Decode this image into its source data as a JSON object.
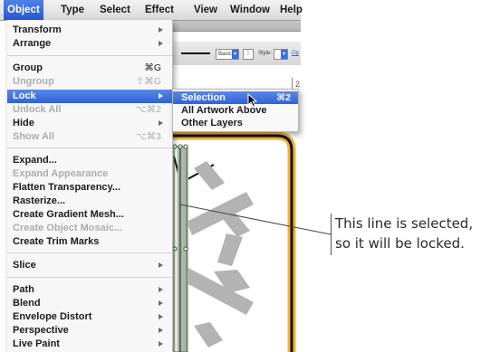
{
  "menubar": {
    "items": [
      {
        "label": "Object",
        "active": true
      },
      {
        "label": "Type"
      },
      {
        "label": "Select"
      },
      {
        "label": "Effect"
      },
      {
        "label": "View"
      },
      {
        "label": "Window"
      },
      {
        "label": "Help"
      }
    ]
  },
  "control_strip": {
    "brush_select": "Basic",
    "style_label": "Style:",
    "opacity_label": "Op"
  },
  "ruler": {
    "mark": "2"
  },
  "object_menu": {
    "items": [
      {
        "label": "Transform",
        "submenu": true
      },
      {
        "label": "Arrange",
        "submenu": true
      },
      {
        "separator": true
      },
      {
        "label": "Group",
        "shortcut": "⌘G"
      },
      {
        "label": "Ungroup",
        "shortcut": "⇧⌘G",
        "disabled": true
      },
      {
        "label": "Lock",
        "submenu": true,
        "highlighted": true
      },
      {
        "label": "Unlock All",
        "shortcut": "⌥⌘2",
        "disabled": true
      },
      {
        "label": "Hide",
        "submenu": true
      },
      {
        "label": "Show All",
        "shortcut": "⌥⌘3",
        "disabled": true
      },
      {
        "separator": true
      },
      {
        "label": "Expand..."
      },
      {
        "label": "Expand Appearance",
        "disabled": true
      },
      {
        "label": "Flatten Transparency..."
      },
      {
        "label": "Rasterize..."
      },
      {
        "label": "Create Gradient Mesh..."
      },
      {
        "label": "Create Object Mosaic...",
        "disabled": true
      },
      {
        "label": "Create Trim Marks"
      },
      {
        "separator": true
      },
      {
        "label": "Slice",
        "submenu": true
      },
      {
        "separator": true
      },
      {
        "label": "Path",
        "submenu": true
      },
      {
        "label": "Blend",
        "submenu": true
      },
      {
        "label": "Envelope Distort",
        "submenu": true
      },
      {
        "label": "Perspective",
        "submenu": true
      },
      {
        "label": "Live Paint",
        "submenu": true
      }
    ]
  },
  "lock_submenu": {
    "items": [
      {
        "label": "Selection",
        "shortcut": "⌘2",
        "highlighted": true
      },
      {
        "label": "All Artwork Above"
      },
      {
        "label": "Other Layers"
      }
    ]
  },
  "callout": {
    "line1": "This line is selected,",
    "line2": "so it will be locked."
  },
  "colors": {
    "menu_highlight": "#2f63d6",
    "artboard_orange": "#f0b23c",
    "snowflake_gray": "#b3b3b3"
  }
}
